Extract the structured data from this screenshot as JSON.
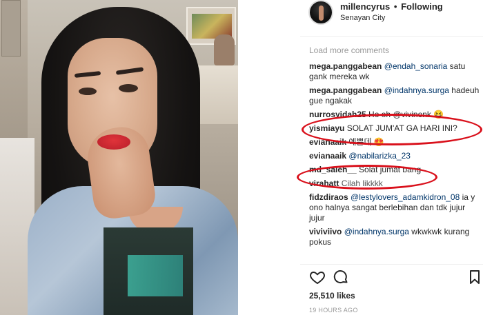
{
  "post": {
    "username": "millencyrus",
    "separator": "•",
    "follow_status": "Following",
    "location": "Senayan City"
  },
  "comments_section": {
    "load_more": "Load more comments",
    "items": [
      {
        "user": "mega.panggabean",
        "mention": "@endah_sonaria",
        "text": " satu gank mereka wk"
      },
      {
        "user": "mega.panggabean",
        "mention": "@indahnya.surga",
        "text": " hadeuh gue ngakak"
      },
      {
        "user": "nurrosyidah25",
        "mention": "",
        "text": " Ho oh @vivinonk 😆"
      },
      {
        "user": "yismiayu",
        "mention": "",
        "text": " SOLAT JUM'AT GA HARI INI?"
      },
      {
        "user": "evianaaik",
        "mention": "",
        "text": " 예쁜데 😍"
      },
      {
        "user": "evianaaik",
        "mention": "@nabilarizka_23",
        "text": ""
      },
      {
        "user": "md_saleh__",
        "mention": "",
        "text": " Solat jumat bang"
      },
      {
        "user": "virahatt",
        "mention": "",
        "text": " Cilah likkkk"
      },
      {
        "user": "fidzdiraos",
        "mention": "@lestylovers_adamkidron_08",
        "text": " ia y ono halnya sangat berlebihan dan tdk jujur jujur"
      },
      {
        "user": "viviviivo",
        "mention": "@indahnya.surga",
        "text": " wkwkwk kurang pokus"
      }
    ]
  },
  "actions": {
    "like_icon": "heart-icon",
    "comment_icon": "comment-bubble-icon",
    "save_icon": "bookmark-icon"
  },
  "stats": {
    "likes": "25,510 likes",
    "time": "19 HOURS AGO"
  },
  "colors": {
    "highlight_circle": "#d9101b",
    "mention": "#003569",
    "muted": "#999999"
  }
}
